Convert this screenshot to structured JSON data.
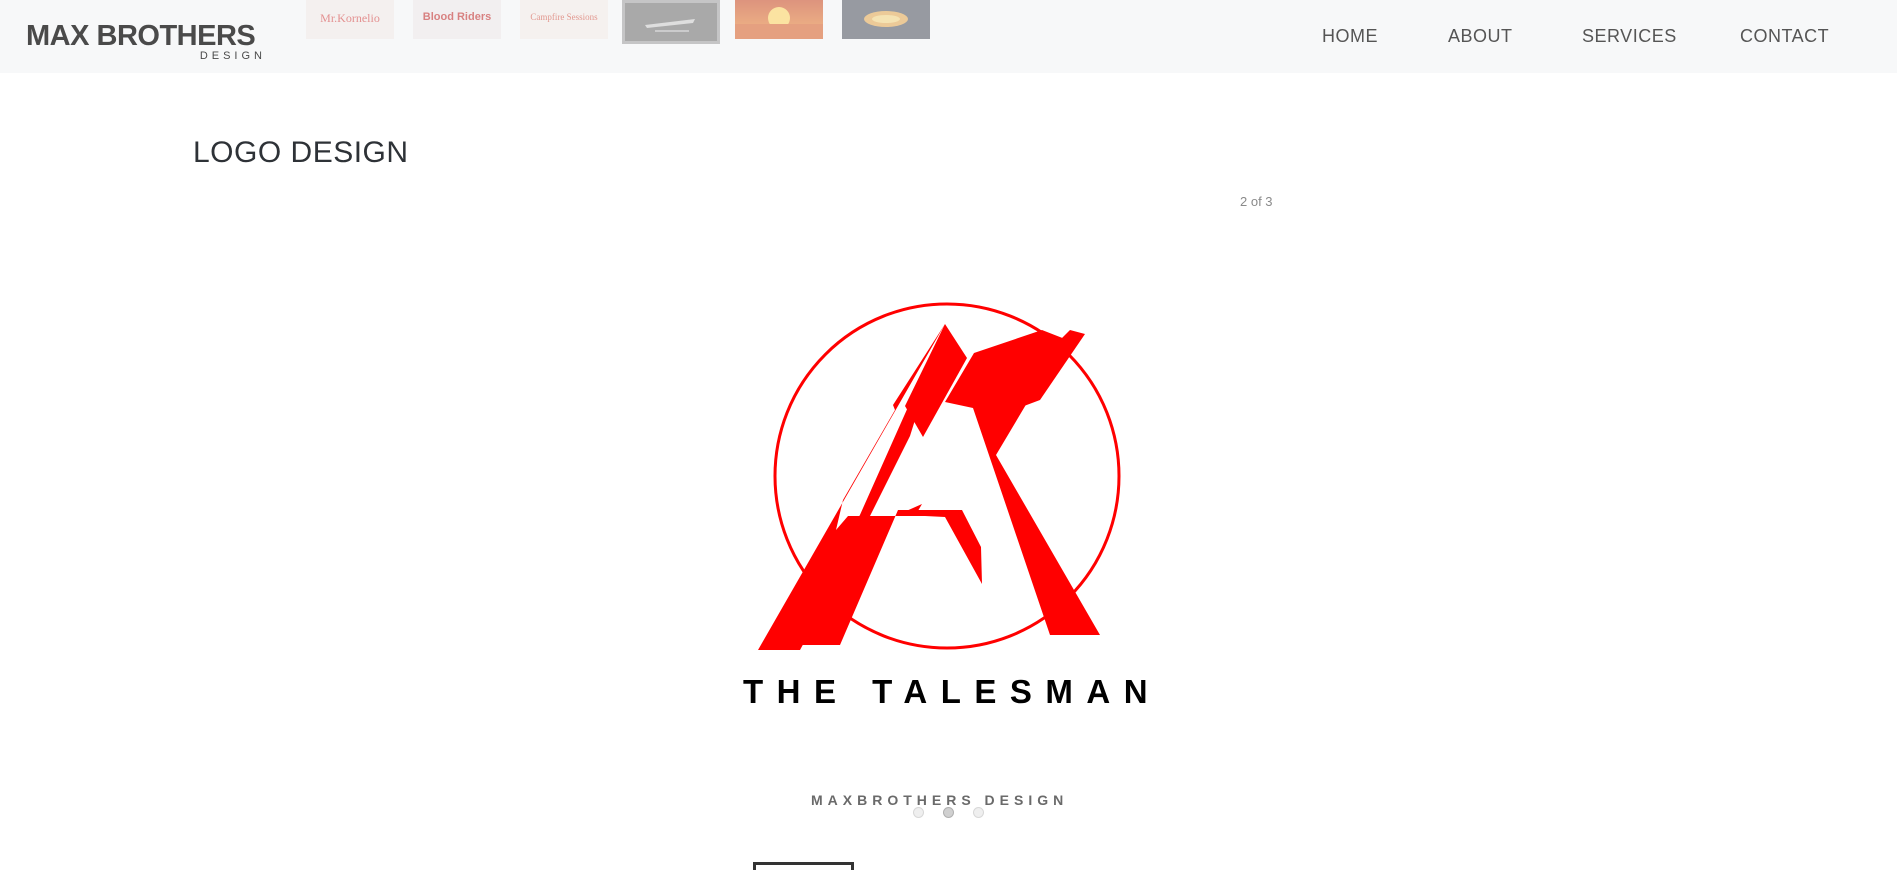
{
  "header": {
    "logo_main": "MAX BROTHERS",
    "logo_sub": "DESIGN",
    "thumbnails": [
      {
        "label": "Mr.Kornelio",
        "bg": "#f3ebe8",
        "fg": "#d43a3a"
      },
      {
        "label": "Blood Riders",
        "bg": "#efe9e9",
        "fg": "#c02020"
      },
      {
        "label": "Campfire Sessions",
        "bg": "#f4ede8",
        "fg": "#d24a3a"
      },
      {
        "label": "",
        "bg": "#8f8f8f",
        "fg": "#d6d6d6"
      },
      {
        "label": "",
        "bg": "#e06a1c",
        "fg": "#ffd35a"
      },
      {
        "label": "",
        "bg": "#4a4f5a",
        "fg": "#e4a64a"
      }
    ],
    "active_thumbnail_index": 3
  },
  "nav": {
    "items": [
      {
        "label": "HOME"
      },
      {
        "label": "ABOUT"
      },
      {
        "label": "SERVICES"
      },
      {
        "label": "CONTACT"
      }
    ]
  },
  "gallery": {
    "title": "LOGO DESIGN",
    "counter": "2 of 3",
    "artwork_title": "THE TALESMAN",
    "studio": "MAXBROTHERS DESIGN",
    "accent": "#ff0000",
    "dots_count": 3,
    "active_dot": 1
  }
}
